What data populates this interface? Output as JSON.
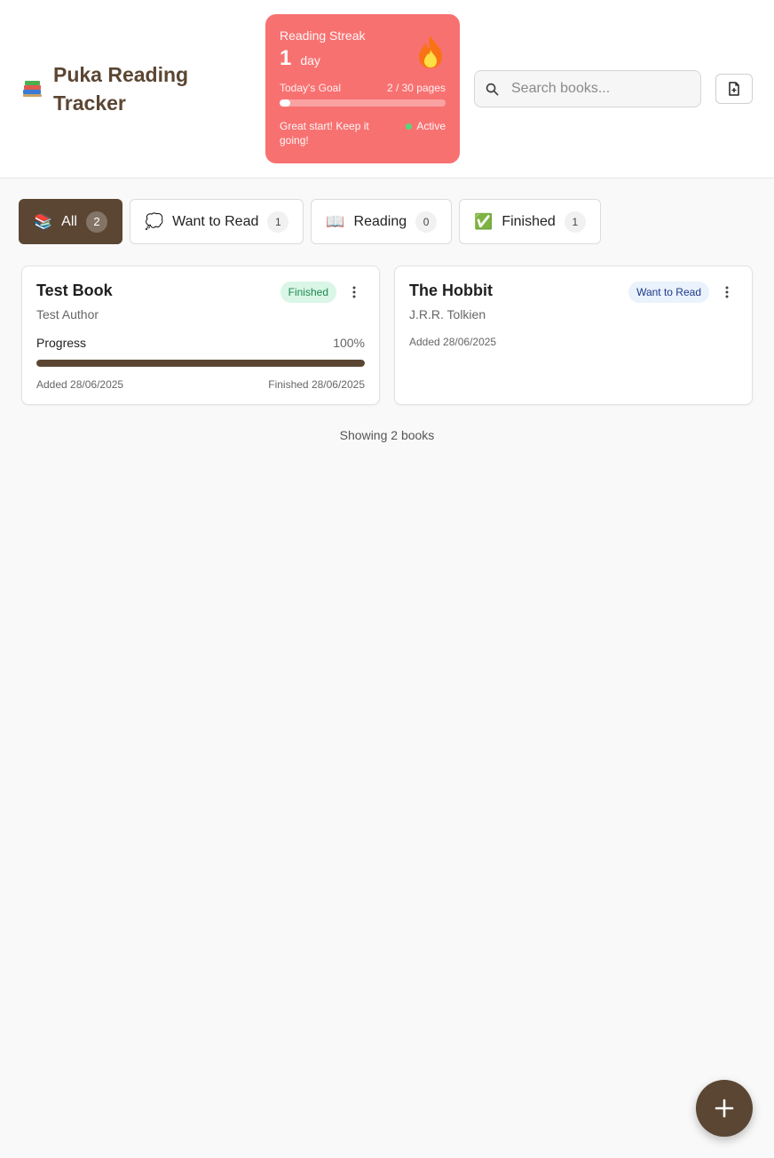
{
  "app": {
    "title": "Puka Reading Tracker",
    "icon": "books-icon"
  },
  "streak": {
    "label": "Reading Streak",
    "count": "1",
    "unit": "day",
    "goal_label": "Today's Goal",
    "goal_value": "2 / 30 pages",
    "goal_progress": 0.0667,
    "message": "Great start! Keep it going!",
    "status": "Active",
    "icon": "flame-icon",
    "color": "#f87171"
  },
  "search": {
    "placeholder": "Search books...",
    "value": ""
  },
  "tabs": [
    {
      "label": "All",
      "emoji": "📚",
      "count": "2",
      "active": true
    },
    {
      "label": "Want to Read",
      "emoji": "💭",
      "count": "1",
      "active": false
    },
    {
      "label": "Reading",
      "emoji": "📖",
      "count": "0",
      "active": false
    },
    {
      "label": "Finished",
      "emoji": "✅",
      "count": "1",
      "active": false
    }
  ],
  "books": [
    {
      "title": "Test Book",
      "author": "Test Author",
      "status": "Finished",
      "progress_label": "Progress",
      "progress_pct": "100%",
      "progress": 1.0,
      "added": "Added 28/06/2025",
      "finished": "Finished 28/06/2025"
    },
    {
      "title": "The Hobbit",
      "author": "J.R.R. Tolkien",
      "status": "Want to Read",
      "added": "Added 28/06/2025"
    }
  ],
  "footer": {
    "count_text": "Showing 2 books"
  },
  "colors": {
    "brand": "#5b4633",
    "finished_badge": "#d9f6e6",
    "want_badge": "#eaf2fc"
  }
}
